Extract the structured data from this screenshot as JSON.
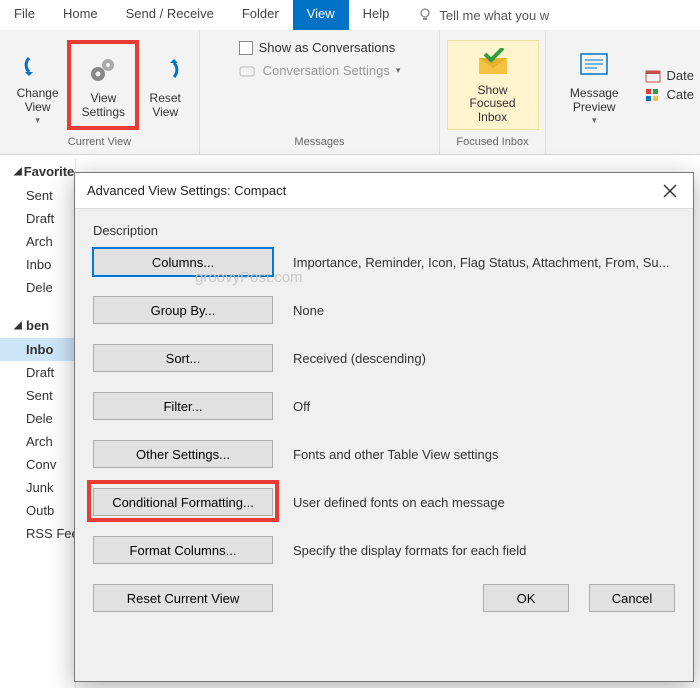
{
  "menu": {
    "items": [
      "File",
      "Home",
      "Send / Receive",
      "Folder",
      "View",
      "Help"
    ],
    "tell_me": "Tell me what you w",
    "active_index": 4
  },
  "ribbon": {
    "current_view": {
      "label": "Current View",
      "change_view": "Change View",
      "view_settings": "View Settings",
      "reset_view": "Reset View"
    },
    "messages": {
      "label": "Messages",
      "show_conv": "Show as Conversations",
      "conv_settings": "Conversation Settings"
    },
    "focused_inbox": {
      "label": "Focused Inbox",
      "button": "Show Focused Inbox"
    },
    "arrangement": {
      "message_preview": "Message Preview",
      "date": "Date",
      "cat": "Cate"
    }
  },
  "nav": {
    "favorites": "Favorites",
    "fav_items": [
      "Sent",
      "Draft",
      "Arch",
      "Inbo",
      "Dele"
    ],
    "account": "ben",
    "acct_items": [
      "Inbo",
      "Draft",
      "Sent",
      "Dele",
      "Arch",
      "Conv",
      "Junk",
      "Outb",
      "RSS Feeds"
    ],
    "selected_index": 0
  },
  "dialog": {
    "title": "Advanced View Settings: Compact",
    "description": "Description",
    "watermark": "groovyPost.com",
    "rows": [
      {
        "btn": "Columns...",
        "val": "Importance, Reminder, Icon, Flag Status, Attachment, From, Su...",
        "primary": true
      },
      {
        "btn": "Group By...",
        "val": "None"
      },
      {
        "btn": "Sort...",
        "val": "Received (descending)"
      },
      {
        "btn": "Filter...",
        "val": "Off"
      },
      {
        "btn": "Other Settings...",
        "val": "Fonts and other Table View settings"
      },
      {
        "btn": "Conditional Formatting...",
        "val": "User defined fonts on each message",
        "highlight": true
      },
      {
        "btn": "Format Columns...",
        "val": "Specify the display formats for each field"
      }
    ],
    "reset": "Reset Current View",
    "ok": "OK",
    "cancel": "Cancel"
  }
}
